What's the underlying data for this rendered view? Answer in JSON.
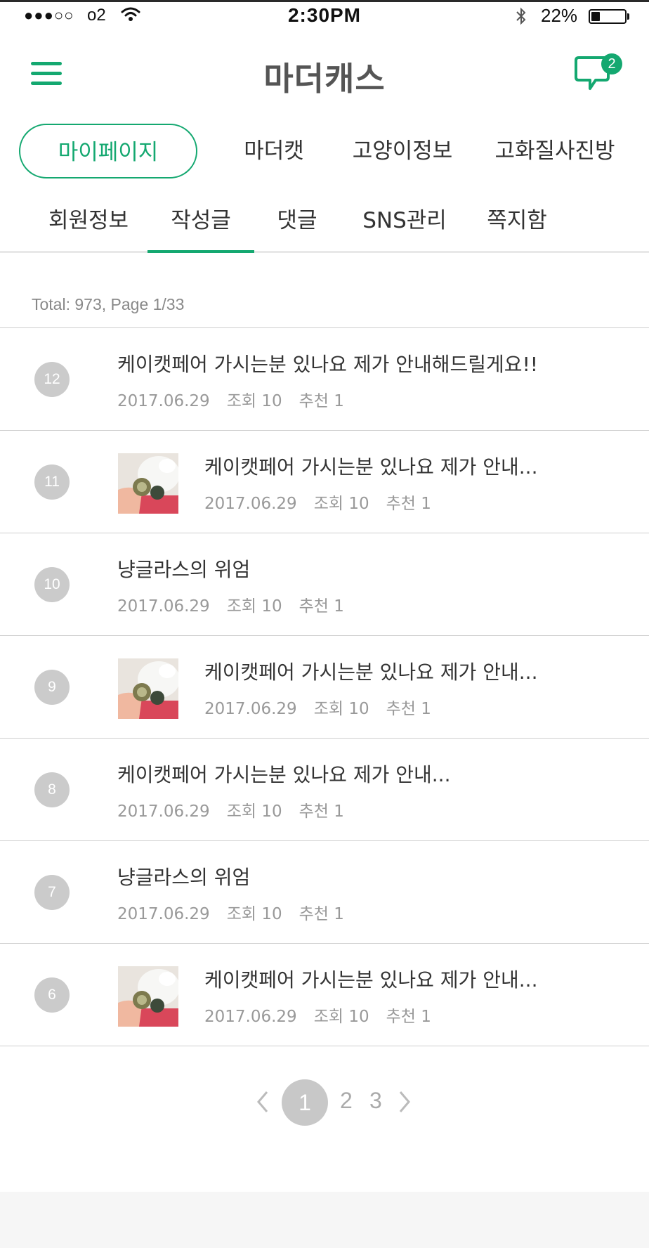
{
  "status": {
    "signal": "●●●○○",
    "carrier": "o2",
    "time": "2:30PM",
    "battery": "22%"
  },
  "header": {
    "logo": "마더캐스",
    "chat_badge": "2",
    "icons": {
      "menu": "hamburger-icon",
      "chat": "chat-bubble-icon"
    }
  },
  "main_tabs": [
    {
      "label": "마이페이지",
      "active": true
    },
    {
      "label": "마더캣"
    },
    {
      "label": "고양이정보"
    },
    {
      "label": "고화질사진방"
    }
  ],
  "sub_tabs": [
    {
      "label": "회원정보"
    },
    {
      "label": "작성글",
      "active": true
    },
    {
      "label": "댓글"
    },
    {
      "label": "SNS관리"
    },
    {
      "label": "쪽지함"
    }
  ],
  "total": "Total: 973, Page 1/33",
  "posts": [
    {
      "num": "12",
      "title": "케이캣페어 가시는분 있나요 제가 안내해드릴게요!!",
      "date": "2017.06.29",
      "views": "조회 10",
      "likes": "추천 1",
      "thumb": false
    },
    {
      "num": "11",
      "title": "케이캣페어 가시는분 있나요 제가 안내...",
      "date": "2017.06.29",
      "views": "조회 10",
      "likes": "추천 1",
      "thumb": true
    },
    {
      "num": "10",
      "title": "냥글라스의 위엄",
      "date": "2017.06.29",
      "views": "조회 10",
      "likes": "추천 1",
      "thumb": false
    },
    {
      "num": "9",
      "title": "케이캣페어 가시는분 있나요 제가 안내...",
      "date": "2017.06.29",
      "views": "조회 10",
      "likes": "추천 1",
      "thumb": true
    },
    {
      "num": "8",
      "title": "케이캣페어 가시는분 있나요 제가 안내...",
      "date": "2017.06.29",
      "views": "조회 10",
      "likes": "추천 1",
      "thumb": false
    },
    {
      "num": "7",
      "title": "냥글라스의 위엄",
      "date": "2017.06.29",
      "views": "조회 10",
      "likes": "추천 1",
      "thumb": false
    },
    {
      "num": "6",
      "title": "케이캣페어 가시는분 있나요 제가 안내...",
      "date": "2017.06.29",
      "views": "조회 10",
      "likes": "추천 1",
      "thumb": true
    }
  ],
  "pagination": {
    "current": "1",
    "pages": [
      "2",
      "3"
    ],
    "icons": {
      "prev": "chevron-left-icon",
      "next": "chevron-right-icon"
    }
  },
  "colors": {
    "accent": "#14a870",
    "badge_gray": "#cbcbcb",
    "divider": "#cfcfcf"
  }
}
